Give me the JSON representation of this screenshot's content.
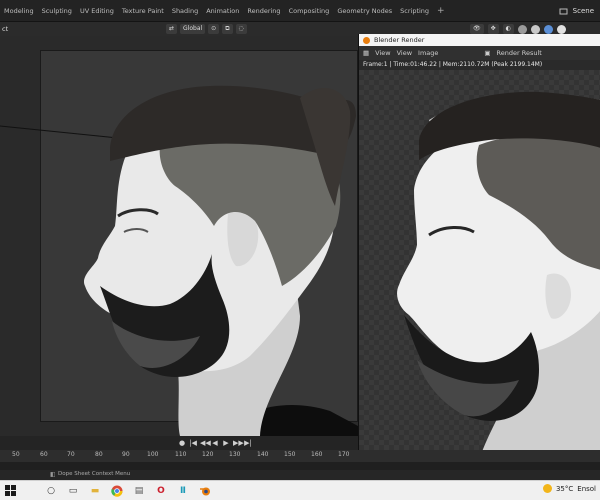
{
  "workspace_tabs": [
    "Modeling",
    "Sculpting",
    "UV Editing",
    "Texture Paint",
    "Shading",
    "Animation",
    "Rendering",
    "Compositing",
    "Geometry Nodes",
    "Scripting"
  ],
  "add_tab": "+",
  "scene_label": "Scene",
  "viewport_header": {
    "context_label": "ct",
    "transform_orientation": "Global"
  },
  "render_window": {
    "title": "Blender Render",
    "menu": [
      "View",
      "View",
      "Image"
    ],
    "slot_label": "Render Result",
    "stats": "Frame:1 | Time:01:46.22 | Mem:2110.72M (Peak 2199.14M)"
  },
  "timeline": {
    "ticks": [
      "50",
      "60",
      "70",
      "80",
      "90",
      "100",
      "110",
      "120",
      "130",
      "140",
      "150",
      "160",
      "170"
    ]
  },
  "status_bar": {
    "text": "Dope Sheet Context Menu"
  },
  "taskbar": {
    "weather_temp": "35°C",
    "weather_text": "Ensol"
  },
  "colors": {
    "accent_orange": "#e87d0d",
    "ui_dark": "#232323",
    "taskbar": "#f0f0f0"
  }
}
